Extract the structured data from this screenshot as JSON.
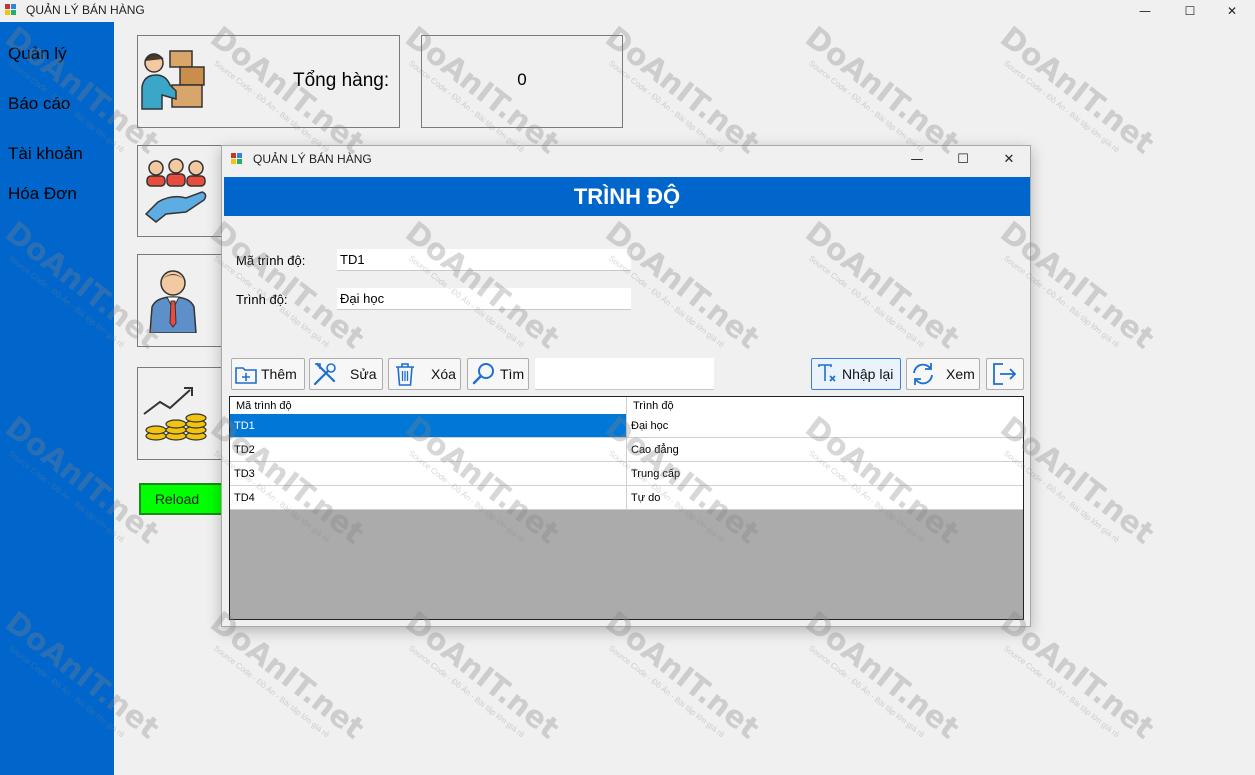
{
  "main_window": {
    "title": "QUẢN LÝ BÁN HÀNG",
    "controls": {
      "minimize": "—",
      "maximize": "☐",
      "close": "✕"
    }
  },
  "sidebar": {
    "items": [
      {
        "label": "Quản lý"
      },
      {
        "label": "Báo cáo"
      },
      {
        "label": "Tài khoản"
      },
      {
        "label": "Hóa Đơn"
      }
    ]
  },
  "dashboard": {
    "total_goods_label": "Tổng hàng:",
    "total_goods_value": "0",
    "reload_label": "Reload"
  },
  "dialog": {
    "title": "QUẢN LÝ BÁN HÀNG",
    "controls": {
      "minimize": "—",
      "maximize": "☐",
      "close": "✕"
    },
    "header": "TRÌNH ĐỘ",
    "form": {
      "code_label": "Mã trình độ:",
      "code_value": "TD1",
      "name_label": "Trình độ:",
      "name_value": "Đại học"
    },
    "toolbar": {
      "add_label": "Thêm",
      "edit_label": "Sửa",
      "delete_label": "Xóa",
      "search_label": "Tìm",
      "search_value": "",
      "reset_label": "Nhập lại",
      "view_label": "Xem"
    },
    "table": {
      "columns": [
        "Mã trình độ",
        "Trình độ"
      ],
      "rows": [
        [
          "TD1",
          "Đại học"
        ],
        [
          "TD2",
          "Cao đẳng"
        ],
        [
          "TD3",
          "Trung cấp"
        ],
        [
          "TD4",
          "Tự do"
        ]
      ],
      "selected_row": 0
    }
  },
  "watermark": {
    "brand": "DoAnIT.net",
    "tagline": "Source Code - Đồ Án - Bài tập lớn giá rẻ"
  },
  "colors": {
    "accent": "#0066cc",
    "selection": "#0078d7",
    "reload": "#00ff00"
  }
}
